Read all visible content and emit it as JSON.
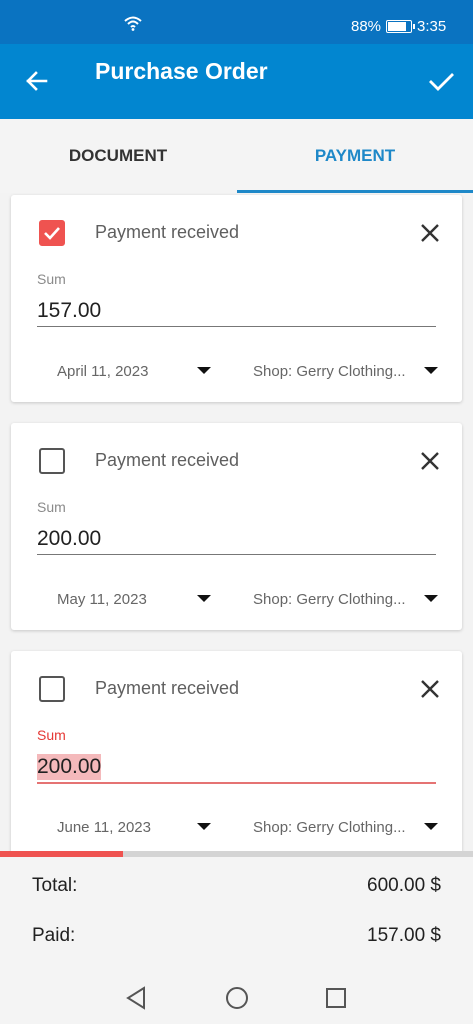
{
  "status": {
    "battery_percent": "88%",
    "battery_level": 0.88,
    "time": "3:35"
  },
  "header": {
    "title": "Purchase Order"
  },
  "tabs": [
    {
      "label": "DOCUMENT"
    },
    {
      "label": "PAYMENT"
    }
  ],
  "payments": [
    {
      "checked": true,
      "label": "Payment received",
      "sum_label": "Sum",
      "sum": "157.00",
      "date": "April 11, 2023",
      "shop": "Shop: Gerry Clothing..."
    },
    {
      "checked": false,
      "label": "Payment received",
      "sum_label": "Sum",
      "sum": "200.00",
      "date": "May 11, 2023",
      "shop": "Shop: Gerry Clothing..."
    },
    {
      "checked": false,
      "label": "Payment received",
      "sum_label": "Sum",
      "sum": "200.00",
      "date": "June 11, 2023",
      "shop": "Shop: Gerry Clothing..."
    }
  ],
  "paid_ratio": 0.26,
  "totals": {
    "total_label": "Total:",
    "total_value": "600.00 $",
    "paid_label": "Paid:",
    "paid_value": "157.00 $"
  },
  "colors": {
    "statusbar": "#0a73c1",
    "appbar": "#0286d0",
    "accent": "#1e88c8",
    "error": "#ef5350"
  },
  "icons": [
    "wifi-icon",
    "battery-icon",
    "back-arrow-icon",
    "check-icon",
    "close-icon",
    "chevron-down-icon",
    "nav-back-icon",
    "nav-home-icon",
    "nav-recent-icon"
  ]
}
